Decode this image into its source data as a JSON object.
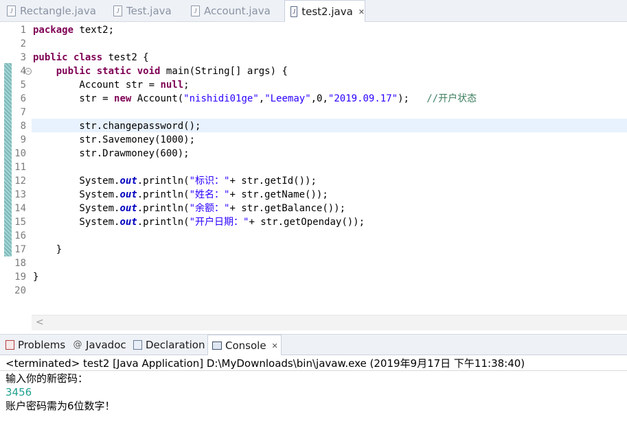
{
  "editor_tabs": [
    {
      "label": "Rectangle.java",
      "active": false
    },
    {
      "label": "Test.java",
      "active": false
    },
    {
      "label": "Account.java",
      "active": false
    },
    {
      "label": "test2.java",
      "active": true,
      "close": "✕"
    }
  ],
  "line_numbers": [
    "1",
    "2",
    "3",
    "4",
    "5",
    "6",
    "7",
    "8",
    "9",
    "10",
    "11",
    "12",
    "13",
    "14",
    "15",
    "16",
    "17",
    "18",
    "19",
    "20"
  ],
  "code": {
    "l1_kw": "package",
    "l1_rest": " text2;",
    "l3_kw1": "public",
    "l3_sp": " ",
    "l3_kw2": "class",
    "l3_rest": " test2 {",
    "l4_indent": "    ",
    "l4_kw1": "public",
    "l4_kw2": "static",
    "l4_kw3": "void",
    "l4_rest": " main(String[] args) {",
    "l5_a": "        Account str = ",
    "l5_kw": "null",
    "l5_b": ";",
    "l6_a": "        str = ",
    "l6_kw": "new",
    "l6_b": " Account(",
    "l6_s1": "\"nishidi01ge\"",
    "l6_c1": ",",
    "l6_s2": "\"Leemay\"",
    "l6_c2": ",0,",
    "l6_s3": "\"2019.09.17\"",
    "l6_c3": ");   ",
    "l6_cmt": "//开户状态",
    "l8": "        str.changepassword();",
    "l9": "        str.Savemoney(1000);",
    "l10": "        str.Drawmoney(600);",
    "l12_a": "        System.",
    "l12_fld": "out",
    "l12_b": ".println(",
    "l12_s": "\"标识：\"",
    "l12_c": "+ str.getId());",
    "l13_a": "        System.",
    "l13_fld": "out",
    "l13_b": ".println(",
    "l13_s": "\"姓名：\"",
    "l13_c": "+ str.getName());",
    "l14_a": "        System.",
    "l14_fld": "out",
    "l14_b": ".println(",
    "l14_s": "\"余额：\"",
    "l14_c": "+ str.getBalance());",
    "l15_a": "        System.",
    "l15_fld": "out",
    "l15_b": ".println(",
    "l15_s": "\"开户日期：\"",
    "l15_c": "+ str.getOpenday());",
    "l17": "    }",
    "l19": "}"
  },
  "scroll_left_arrow": "<",
  "bottom_tabs": [
    {
      "label": "Problems",
      "icon": "problems-icon"
    },
    {
      "label": "Javadoc",
      "icon": "javadoc-icon",
      "glyph": "@"
    },
    {
      "label": "Declaration",
      "icon": "declaration-icon"
    },
    {
      "label": "Console",
      "icon": "console-icon",
      "active": true,
      "close": "✕"
    }
  ],
  "console": {
    "status": "<terminated> test2 [Java Application] D:\\MyDownloads\\bin\\javaw.exe (2019年9月17日 下午11:38:40)",
    "line1": "输入你的新密码：",
    "line2": "3456",
    "line3": "账户密码需为6位数字！"
  },
  "colors": {
    "keyword": "#7f0055",
    "string": "#2a00ff",
    "comment": "#3f7f5f",
    "field": "#0000c0",
    "input_echo": "#20a090"
  }
}
